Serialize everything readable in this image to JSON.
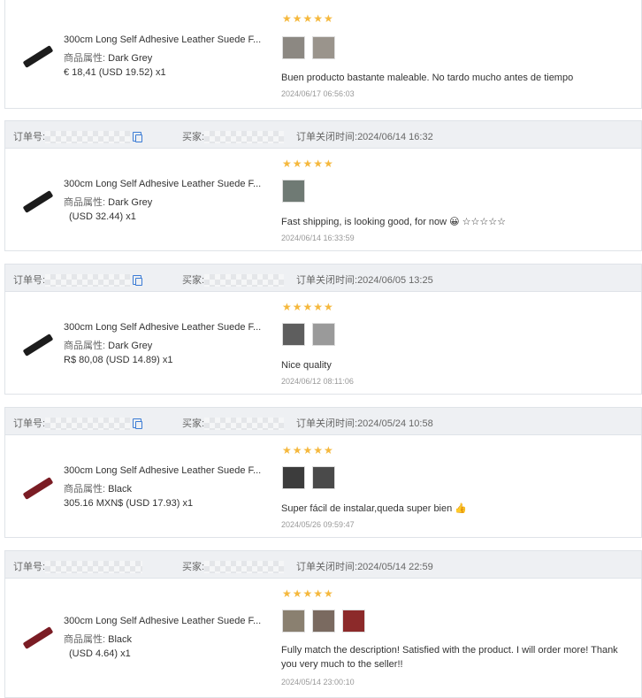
{
  "header_labels": {
    "order_no": "订单号:",
    "buyer": "买家:",
    "close_time": "订单关闭时间:"
  },
  "orders": [
    {
      "close_time": "",
      "product": {
        "title": "300cm Long Self Adhesive Leather Suede F...",
        "attr_label": "商品属性:",
        "attr_value": "Dark Grey",
        "price": "€ 18,41  (USD  19.52)  x1",
        "color": "#1c1c1c"
      },
      "stars": "★★★★★",
      "review": "Buen producto bastante maleable. No tardo mucho antes de tiempo",
      "review_time": "2024/06/17 06:56:03",
      "thumb_colors": [
        "#8c8882",
        "#9a948c"
      ]
    },
    {
      "close_time": "2024/06/14 16:32",
      "product": {
        "title": "300cm Long Self Adhesive Leather Suede F...",
        "attr_label": "商品属性:",
        "attr_value": "Dark Grey",
        "price": "(USD  32.44)  x1",
        "color": "#1c1c1c"
      },
      "stars": "★★★★★",
      "review": "Fast shipping, is looking good, for now 😀 ☆☆☆☆☆",
      "review_time": "2024/06/14 16:33:59",
      "thumb_colors": [
        "#6f7a74"
      ]
    },
    {
      "close_time": "2024/06/05 13:25",
      "product": {
        "title": "300cm Long Self Adhesive Leather Suede F...",
        "attr_label": "商品属性:",
        "attr_value": "Dark Grey",
        "price": "R$ 80,08  (USD  14.89)  x1",
        "color": "#1c1c1c"
      },
      "stars": "★★★★★",
      "review": "Nice quality",
      "review_time": "2024/06/12 08:11:06",
      "thumb_colors": [
        "#5e5e5e",
        "#9a9a9a"
      ]
    },
    {
      "close_time": "2024/05/24 10:58",
      "product": {
        "title": "300cm Long Self Adhesive Leather Suede F...",
        "attr_label": "商品属性:",
        "attr_value": "Black",
        "price": "305.16 MXN$  (USD  17.93)  x1",
        "color": "#7a1c24"
      },
      "stars": "★★★★★",
      "review": "Super fácil de instalar,queda super bien 👍",
      "review_time": "2024/05/26 09:59:47",
      "thumb_colors": [
        "#3c3c3c",
        "#4a4a4a"
      ]
    },
    {
      "close_time": "2024/05/14 22:59",
      "product": {
        "title": "300cm Long Self Adhesive Leather Suede F...",
        "attr_label": "商品属性:",
        "attr_value": "Black",
        "price": "(USD  4.64)  x1",
        "color": "#7a1c24"
      },
      "stars": "★★★★★",
      "review": "Fully match the description! Satisfied with the product. I will order more! Thank you very much to the seller!!",
      "review_time": "2024/05/14 23:00:10",
      "thumb_colors": [
        "#8a8070",
        "#7a6a60",
        "#8c2a2a"
      ]
    }
  ]
}
